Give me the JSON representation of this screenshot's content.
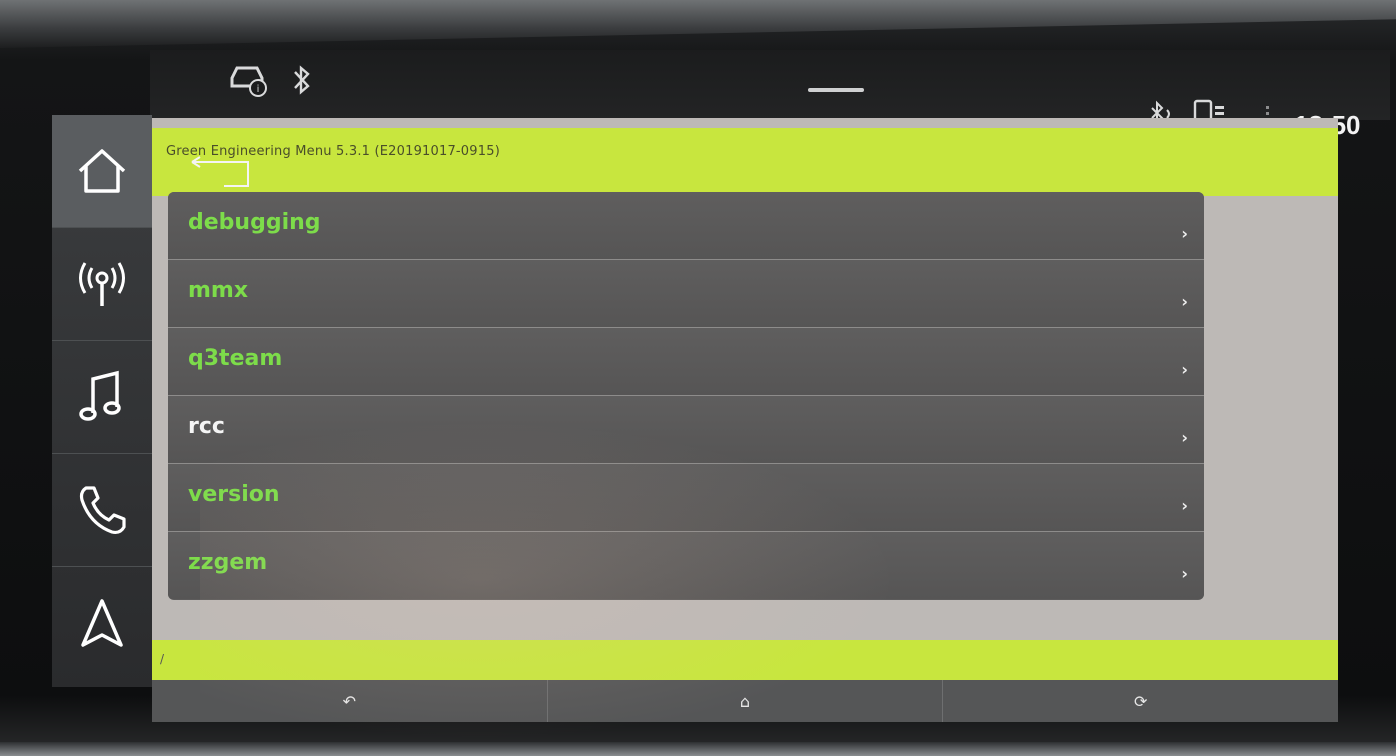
{
  "status_bar": {
    "clock": "18:50",
    "icons": [
      "car-info-icon",
      "bluetooth-icon",
      "bluetooth-audio-icon",
      "phone-battery-icon",
      "signal-icon"
    ]
  },
  "left_nav": {
    "items": [
      {
        "name": "home",
        "icon": "home-icon"
      },
      {
        "name": "radio",
        "icon": "radio-antenna-icon"
      },
      {
        "name": "media",
        "icon": "music-note-icon"
      },
      {
        "name": "phone",
        "icon": "phone-icon"
      },
      {
        "name": "navigation",
        "icon": "navigation-arrow-icon"
      }
    ]
  },
  "app": {
    "title": "Green Engineering Menu 5.3.1 (E20191017-0915)",
    "menu_items": [
      {
        "label": "debugging"
      },
      {
        "label": "mmx"
      },
      {
        "label": "q3team"
      },
      {
        "label": "rcc"
      },
      {
        "label": "version"
      },
      {
        "label": "zzgem"
      }
    ],
    "softkeys": [
      {
        "glyph": "↶",
        "icon": "back-icon"
      },
      {
        "glyph": "⌂",
        "icon": "home-icon"
      },
      {
        "glyph": "⟳",
        "icon": "refresh-icon"
      }
    ]
  },
  "colors": {
    "accent_green": "#c8e63e",
    "label_green": "#7ddc4a",
    "list_background": "#5c5b5b"
  }
}
